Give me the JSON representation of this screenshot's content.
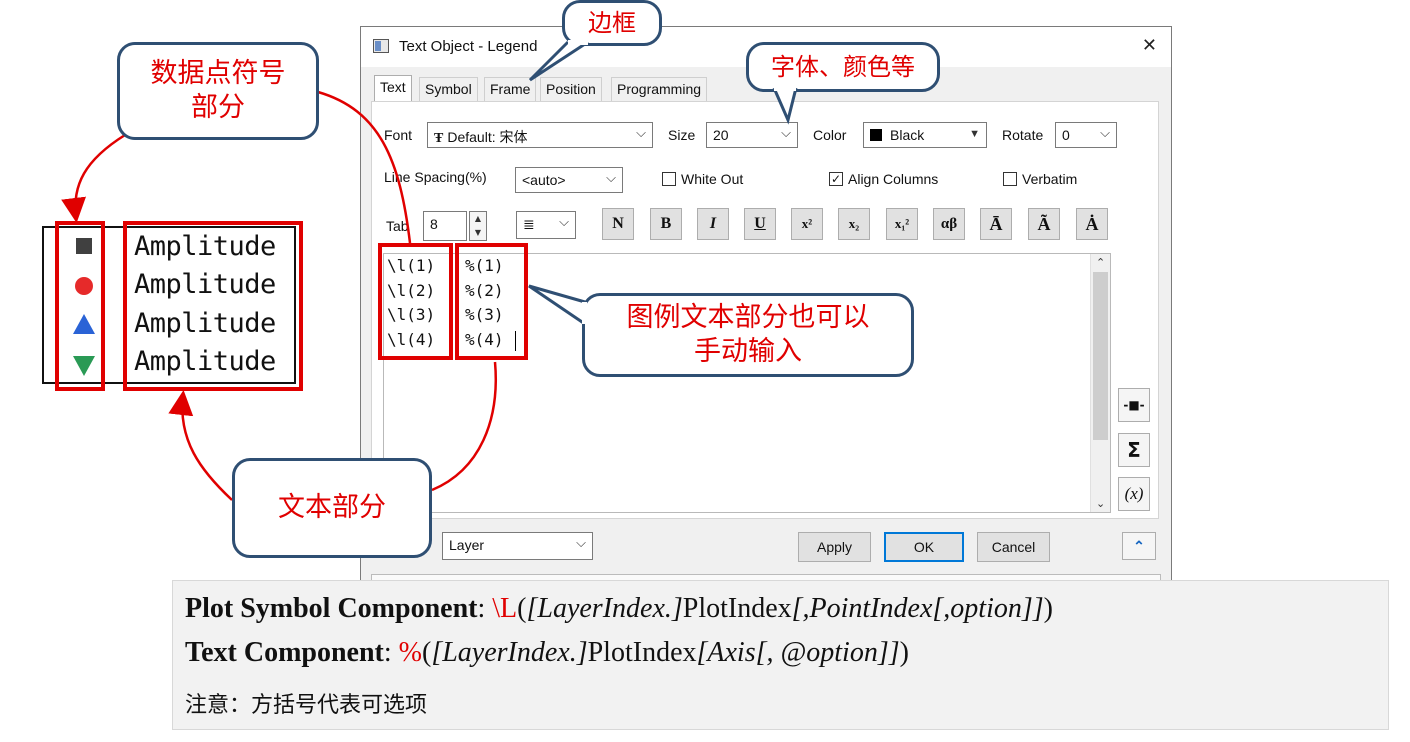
{
  "legend": {
    "symbols": [
      "black-square",
      "red-circle",
      "blue-triangle-up",
      "green-triangle-down"
    ],
    "entries": [
      "Amplitude",
      "Amplitude",
      "Amplitude",
      "Amplitude"
    ]
  },
  "callouts": {
    "symbol_part": "数据点符号\n部分",
    "frame": "边框",
    "font_color": "字体、颜色等",
    "manual_input": "图例文本部分也可以\n手动输入",
    "text_part": "文本部分"
  },
  "dialog": {
    "title": "Text Object - Legend",
    "close": "✕",
    "tabs": [
      "Text",
      "Symbol",
      "Frame",
      "Position",
      "Programming"
    ],
    "font_label": "Font",
    "font_value": "Default: 宋体",
    "size_label": "Size",
    "size_value": "20",
    "color_label": "Color",
    "color_value": "Black",
    "rotate_label": "Rotate",
    "rotate_value": "0",
    "line_spacing_label": "Line Spacing(%)",
    "line_spacing_value": "<auto>",
    "white_out": "White Out",
    "white_out_checked": false,
    "align_columns": "Align Columns",
    "align_columns_checked": true,
    "verbatim": "Verbatim",
    "verbatim_checked": false,
    "tab_label": "Tab",
    "tab_value": "8",
    "format_buttons": [
      "N",
      "B",
      "I",
      "U",
      "x²",
      "x₂",
      "x₁²",
      "αβ",
      "Ā",
      "Ã",
      "Ȧ"
    ],
    "code_left": [
      "\\l(1)",
      "\\l(2)",
      "\\l(3)",
      "\\l(4)"
    ],
    "code_right": [
      "%(1)",
      "%(2)",
      "%(3)",
      "%(4)"
    ],
    "side_buttons": [
      "-■-",
      "Σ",
      "(x)"
    ],
    "layer_value": "Layer",
    "apply": "Apply",
    "ok": "OK",
    "cancel": "Cancel",
    "expand": "⌃"
  },
  "notes": {
    "line1_label": "Plot Symbol Component",
    "line1_colon": ": ",
    "line1_code": "\\L",
    "line1_paren_open": "(",
    "line1_i1": "[LayerIndex.]",
    "line1_mid": "PlotIndex",
    "line1_i2": "[,PointIndex[,option]]",
    "line1_paren_close": ")",
    "line2_label": "Text Component",
    "line2_colon": ": ",
    "line2_code": "%",
    "line2_paren_open": "(",
    "line2_i1": "[LayerIndex.]",
    "line2_mid": "PlotIndex",
    "line2_i2": "[Axis[, @option]]",
    "line2_paren_close": ")",
    "line3": "注意：方括号代表可选项"
  },
  "colors": {
    "highlight_red": "#e00000",
    "callout_border": "#2f4f73",
    "symbol_black": "#404040",
    "symbol_red": "#e62a2a",
    "symbol_blue": "#2a63d6",
    "symbol_green": "#2a9a55"
  }
}
